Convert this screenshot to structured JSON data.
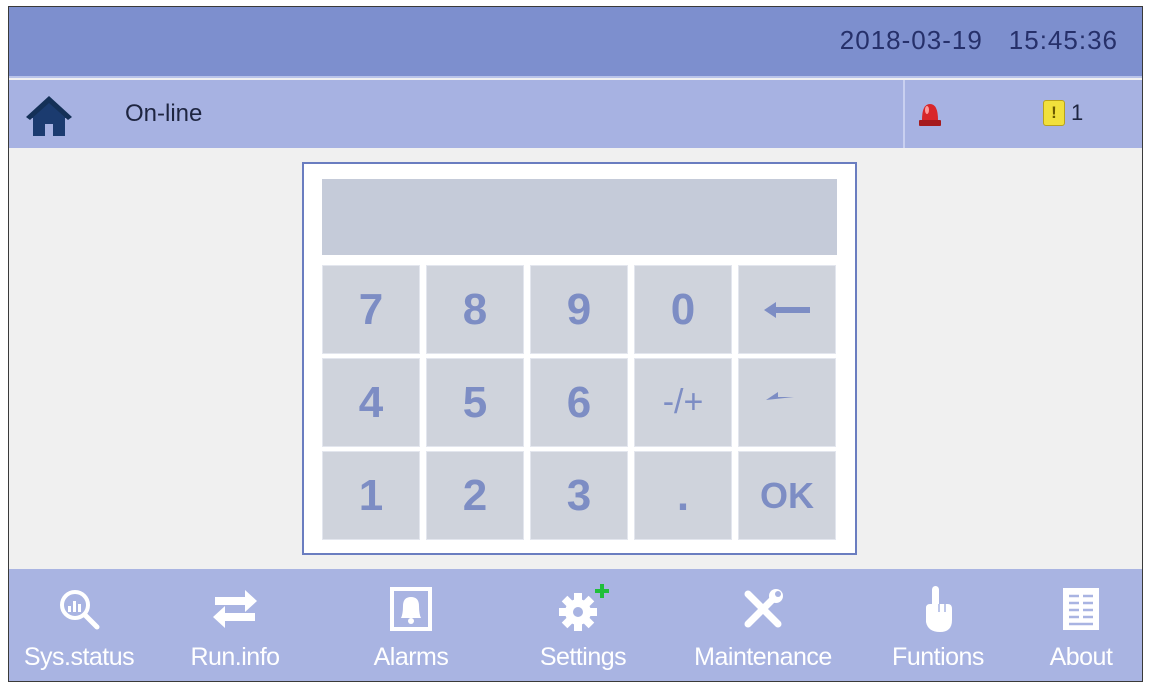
{
  "header": {
    "date": "2018-03-19",
    "time": "15:45:36"
  },
  "status": {
    "text": "On-line",
    "home_icon": "home-icon",
    "alarm_icon": "siren-icon",
    "warning_icon_glyph": "!",
    "warning_count": "1"
  },
  "keypad": {
    "display_value": "",
    "keys": {
      "k7": "7",
      "k8": "8",
      "k9": "9",
      "k0": "0",
      "backspace": "⟵",
      "k4": "4",
      "k5": "5",
      "k6": "6",
      "sign": "-/+",
      "back": "↩",
      "k1": "1",
      "k2": "2",
      "k3": "3",
      "dot": ".",
      "ok": "OK"
    }
  },
  "nav": {
    "sys_status": "Sys.status",
    "run_info": "Run.info",
    "alarms": "Alarms",
    "settings": "Settings",
    "maintenance": "Maintenance",
    "functions": "Funtions",
    "about": "About"
  },
  "colors": {
    "topbar": "#7d8fce",
    "statusbar": "#a7b2e2",
    "bottombar": "#a9b4e2",
    "key_bg": "#cfd3dc",
    "key_text": "#7d8dc4",
    "settings_plus": "#1fbf3a"
  }
}
